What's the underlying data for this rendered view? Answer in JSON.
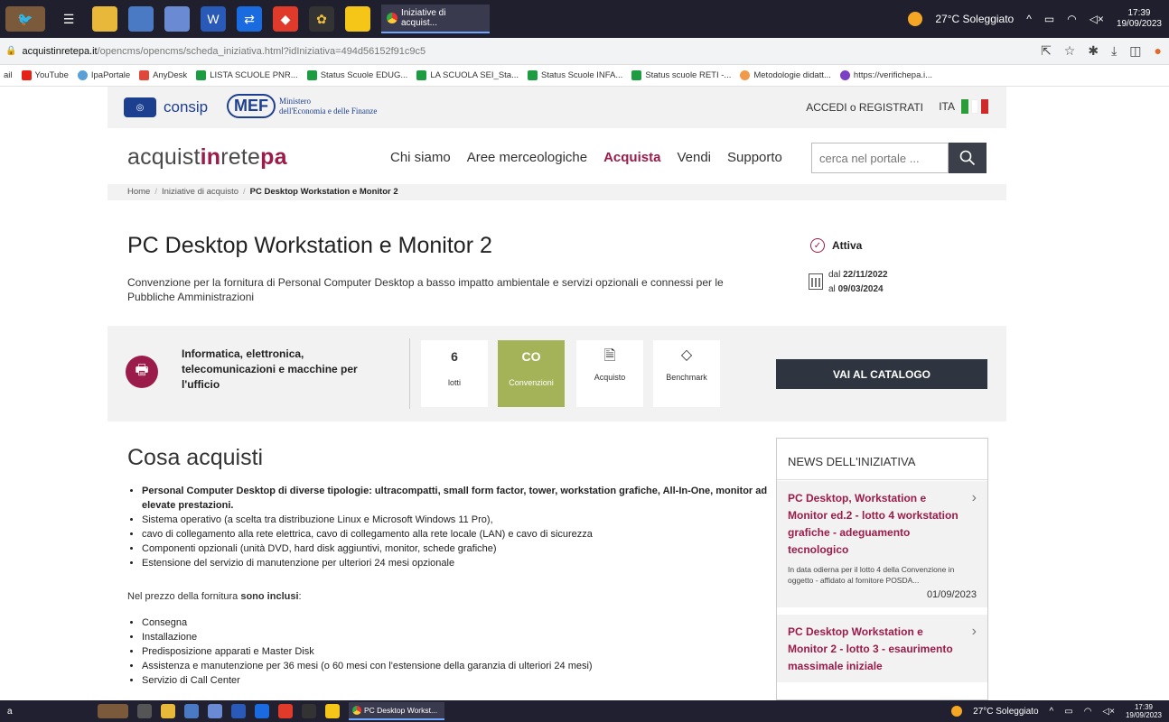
{
  "taskbar": {
    "tab_title": "Iniziative di acquist...",
    "weather": "27°C Soleggiato",
    "time": "17:39",
    "date": "19/09/2023"
  },
  "addressbar": {
    "domain": "acquistinretepa.it",
    "path": "/opencms/opencms/scheda_iniziativa.html?idIniziativa=494d56152f91c9c5"
  },
  "bookmarks": [
    {
      "label": "ail",
      "color": "#ffffff"
    },
    {
      "label": "YouTube",
      "color": "#e62117"
    },
    {
      "label": "IpaPortale",
      "color": "#5aa0d8"
    },
    {
      "label": "AnyDesk",
      "color": "#e0463a"
    },
    {
      "label": "LISTA SCUOLE PNR...",
      "color": "#1e9c42"
    },
    {
      "label": "Status Scuole EDUG...",
      "color": "#1e9c42"
    },
    {
      "label": "LA SCUOLA SEI_Sta...",
      "color": "#1e9c42"
    },
    {
      "label": "Status Scuole INFA...",
      "color": "#1e9c42"
    },
    {
      "label": "Status scuole RETI -...",
      "color": "#1e9c42"
    },
    {
      "label": "Metodologie didatt...",
      "color": "#f09a4a"
    },
    {
      "label": "https://verifichepa.i...",
      "color": "#7a3fc4"
    }
  ],
  "header": {
    "consip": "consip",
    "mef_short": "MEF",
    "mef_line1": "Ministero",
    "mef_line2": "dell'Economia e delle Finanze",
    "accedi": "ACCEDI o REGISTRATI",
    "lang": "ITA"
  },
  "nav": {
    "brand_a": "acquist",
    "brand_b": "in",
    "brand_c": "rete",
    "brand_d": "pa",
    "items": [
      "Chi siamo",
      "Aree merceologiche",
      "Acquista",
      "Vendi",
      "Supporto"
    ],
    "search_placeholder": "cerca nel portale ..."
  },
  "breadcrumb": {
    "home": "Home",
    "level1": "Iniziative di acquisto",
    "current": "PC Desktop Workstation e Monitor 2"
  },
  "main": {
    "title": "PC Desktop Workstation e Monitor 2",
    "subtitle": "Convenzione per la fornitura di Personal Computer Desktop a basso impatto ambientale e servizi opzionali e connessi per le Pubbliche Amministrazioni",
    "status": "Attiva",
    "date_from_prefix": "dal ",
    "date_from": "22/11/2022",
    "date_to_prefix": "al ",
    "date_to": "09/03/2024"
  },
  "category": {
    "label": "Informatica, elettronica, telecomunicazioni e macchine per l'ufficio",
    "lotti_value": "6",
    "lotti_label": "lotti",
    "conv_value": "CO",
    "conv_label": "Convenzioni",
    "acquisto_label": "Acquisto",
    "benchmark_label": "Benchmark",
    "catalog_button": "VAI AL CATALOGO"
  },
  "cosa": {
    "title": "Cosa acquisti",
    "items": [
      "Personal Computer Desktop di diverse tipologie: ultracompatti, small form factor, tower, workstation grafiche, All-In-One, monitor ad elevate prestazioni.",
      "Sistema operativo (a scelta tra distribuzione Linux e Microsoft Windows 11 Pro),",
      "cavo di collegamento alla rete elettrica, cavo di collegamento alla rete locale (LAN) e cavo di sicurezza",
      "Componenti opzionali (unità DVD, hard disk aggiuntivi, monitor, schede grafiche)",
      "Estensione del servizio di manutenzione per ulteriori 24 mesi opzionale"
    ],
    "prezzo_prefix": "Nel prezzo della fornitura ",
    "prezzo_bold": "sono inclusi",
    "prezzo_suffix": ":",
    "included": [
      "Consegna",
      "Installazione",
      "Predisposizione apparati e Master Disk",
      "Assistenza e manutenzione per 36 mesi (o 60 mesi con l'estensione della garanzia di ulteriori 24 mesi)",
      "Servizio di Call Center"
    ]
  },
  "news": {
    "heading": "NEWS DELL'INIZIATIVA",
    "items": [
      {
        "title": "PC Desktop, Workstation e Monitor ed.2 - lotto 4 workstation grafiche - adeguamento tecnologico",
        "excerpt": "In data odierna  per il lotto 4 della Convenzione in oggetto - affidato al fornitore POSDA...",
        "date": "01/09/2023"
      },
      {
        "title": "PC Desktop Workstation e Monitor 2 - lotto 3 - esaurimento massimale iniziale",
        "excerpt": "",
        "date": ""
      }
    ]
  },
  "taskbar_bottom": {
    "tab_title": "PC Desktop Workst...",
    "weather": "27°C Soleggiato",
    "time": "17:39",
    "date": "19/09/2023",
    "left_char": "a"
  }
}
